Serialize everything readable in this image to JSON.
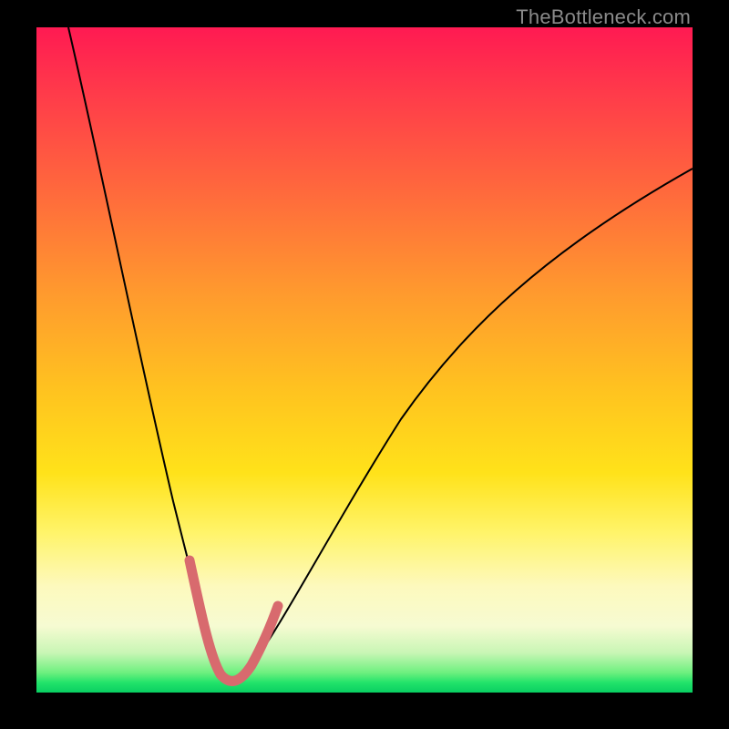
{
  "watermark": "TheBottleneck.com",
  "colors": {
    "accent_stroke": "#d86a6e",
    "curve_stroke": "#000000",
    "gradient_top": "#ff1a52",
    "gradient_bottom": "#09cf62"
  },
  "chart_data": {
    "type": "line",
    "title": "",
    "xlabel": "",
    "ylabel": "",
    "xlim": [
      0,
      100
    ],
    "ylim": [
      0,
      100
    ],
    "grid": false,
    "legend": false,
    "annotations": [],
    "notes": "Curve shows mismatch/bottleneck percentage vs. an unlabeled x-axis. Minimum (near-zero bottleneck, green zone) occurs around x≈28. Pink segment highlights the near-optimal region roughly x∈[23,34].",
    "series": [
      {
        "name": "bottleneck-curve",
        "x": [
          0,
          3,
          6,
          9,
          12,
          15,
          18,
          21,
          24,
          26,
          28,
          30,
          33,
          37,
          42,
          48,
          55,
          63,
          72,
          82,
          92,
          100
        ],
        "values": [
          100,
          92,
          83,
          73,
          63,
          52,
          41,
          30,
          17,
          8,
          2,
          4,
          10,
          20,
          31,
          42,
          52,
          61,
          68,
          74,
          78,
          80
        ]
      }
    ],
    "highlight_range": {
      "x_start": 23,
      "x_end": 34
    }
  }
}
